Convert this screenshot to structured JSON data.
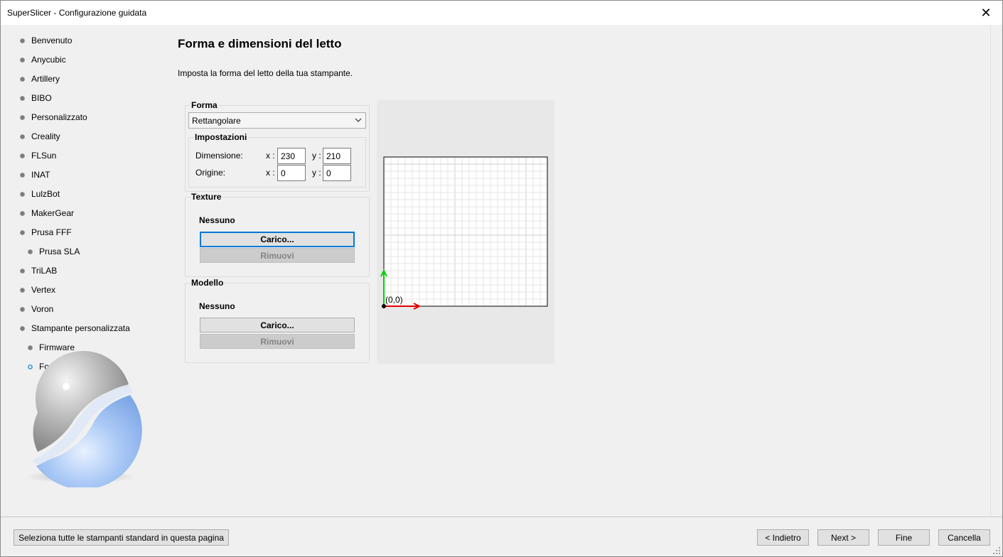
{
  "window": {
    "title": "SuperSlicer - Configurazione guidata",
    "close_glyph": "✕"
  },
  "sidebar": {
    "items": [
      {
        "label": "Benvenuto",
        "level": 0,
        "active": false
      },
      {
        "label": "Anycubic",
        "level": 0,
        "active": false
      },
      {
        "label": "Artillery",
        "level": 0,
        "active": false
      },
      {
        "label": "BIBO",
        "level": 0,
        "active": false
      },
      {
        "label": "Personalizzato",
        "level": 0,
        "active": false
      },
      {
        "label": "Creality",
        "level": 0,
        "active": false
      },
      {
        "label": "FLSun",
        "level": 0,
        "active": false
      },
      {
        "label": "INAT",
        "level": 0,
        "active": false
      },
      {
        "label": "LulzBot",
        "level": 0,
        "active": false
      },
      {
        "label": "MakerGear",
        "level": 0,
        "active": false
      },
      {
        "label": "Prusa FFF",
        "level": 0,
        "active": false
      },
      {
        "label": "Prusa SLA",
        "level": 1,
        "active": false
      },
      {
        "label": "TriLAB",
        "level": 0,
        "active": false
      },
      {
        "label": "Vertex",
        "level": 0,
        "active": false
      },
      {
        "label": "Voron",
        "level": 0,
        "active": false
      },
      {
        "label": "Stampante personalizzata",
        "level": 0,
        "active": false
      },
      {
        "label": "Firmware",
        "level": 1,
        "active": false
      },
      {
        "label": "Forma del letto",
        "level": 1,
        "active": true
      }
    ]
  },
  "main": {
    "title": "Forma e dimensioni del letto",
    "description": "Imposta la forma del letto della tua stampante.",
    "shape": {
      "group_label": "Forma",
      "selected": "Rettangolare",
      "settings_label": "Impostazioni",
      "size_label": "Dimensione:",
      "origin_label": "Origine:",
      "x_prefix": "x :",
      "y_prefix": "y :",
      "size_x": "230",
      "size_y": "210",
      "origin_x": "0",
      "origin_y": "0"
    },
    "texture": {
      "group_label": "Texture",
      "value": "Nessuno",
      "load_label": "Carico...",
      "remove_label": "Rimuovi"
    },
    "model": {
      "group_label": "Modello",
      "value": "Nessuno",
      "load_label": "Carico...",
      "remove_label": "Rimuovi"
    },
    "preview": {
      "origin_label": "(0,0)",
      "x_axis_color": "#e00000",
      "y_axis_color": "#00d000"
    }
  },
  "footer": {
    "select_all_label": "Seleziona tutte le stampanti standard in questa pagina",
    "back_label": "< Indietro",
    "next_label": "Next >",
    "finish_label": "Fine",
    "cancel_label": "Cancella"
  },
  "colors": {
    "accent": "#0078d7",
    "active_bullet": "#56a3da"
  }
}
